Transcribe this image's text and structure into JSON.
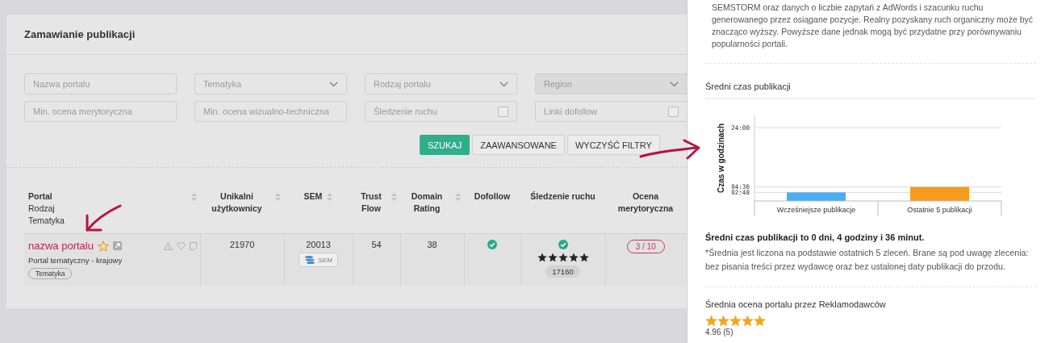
{
  "page": {
    "title": "Zamawianie publikacji"
  },
  "filters": [
    {
      "kind": "text",
      "placeholder": "Nazwa portalu"
    },
    {
      "kind": "select",
      "placeholder": "Tematyka",
      "disabled": false
    },
    {
      "kind": "select",
      "placeholder": "Rodzaj portalu",
      "disabled": false
    },
    {
      "kind": "select",
      "placeholder": "Region",
      "disabled": true
    },
    {
      "kind": "text",
      "placeholder": "Min. ocena merytoryczna"
    },
    {
      "kind": "text",
      "placeholder": "Min. ocena wizualno-techniczna"
    },
    {
      "kind": "checkbox",
      "label": "Śledzenie ruchu",
      "checked": false
    },
    {
      "kind": "checkbox",
      "label": "Linki dofollow",
      "checked": false
    }
  ],
  "buttons": [
    {
      "label": "SZUKAJ",
      "kind": "primary"
    },
    {
      "label": "ZAAWANSOWANE",
      "kind": "default"
    },
    {
      "label": "WYCZYŚĆ FILTRY",
      "kind": "default"
    }
  ],
  "table": {
    "columns": [
      {
        "label": "Portal",
        "sublabels": [
          "Rodzaj",
          "Tematyka"
        ],
        "sortable": true
      },
      {
        "label": "Unikalni użytkownicy",
        "sortable": true
      },
      {
        "label": "SEM",
        "sortable": true
      },
      {
        "label": "Trust Flow",
        "sortable": true
      },
      {
        "label": "Domain Rating",
        "sortable": true
      },
      {
        "label": "Dofollow",
        "sortable": false
      },
      {
        "label": "Śledzenie ruchu",
        "sortable": false
      },
      {
        "label": "Ocena merytoryczna",
        "sortable": false
      }
    ],
    "rows": [
      {
        "portal_name": "nazwa portalu",
        "favorite": false,
        "portal_type": "Portal tematyczny - krajowy",
        "tag": "Tematyka",
        "unique_users": "21970",
        "sem": "20013",
        "sem_badge": "SEM",
        "trust_flow": "54",
        "domain_rating": "38",
        "dofollow": true,
        "tracking": true,
        "stars": 5,
        "tracking_count": "17160",
        "rating": "3 / 10"
      }
    ]
  },
  "panel": {
    "intro": "SEMSTORM oraz danych o liczbie zapytań z AdWords i szacunku ruchu generowanego przez osiągane pozycje. Realny pozyskany ruch organiczny może być znacząco wyższy. Powyższe dane jednak mogą być przydatne przy porównywaniu popularności portali.",
    "time_section": {
      "title": "Średni czas publikacji",
      "chart_data": {
        "type": "bar",
        "ylabel": "Czas w godzinach",
        "categories": [
          "Wcześniejsze publikacje",
          "Ostatnie 5 publikacji"
        ],
        "series": [
          {
            "color": "#4aaef5",
            "values": [
              2.8,
              null
            ]
          },
          {
            "color": "#f59c1f",
            "values": [
              null,
              4.6
            ]
          }
        ],
        "ylim": [
          0,
          28
        ],
        "grid": true,
        "yticks": [
          {
            "value": 2.8,
            "label": "02:48"
          },
          {
            "value": 4.6,
            "label": "04:36"
          },
          {
            "value": 24,
            "label": "24:00"
          }
        ]
      },
      "summary": "Średni czas publikacji to 0 dni, 4 godziny i 36 minut.",
      "note": "*Średnia jest liczona na podstawie ostatnich 5 zleceń. Brane są pod uwagę zlecenia: bez pisania treści przez wydawcę oraz bez ustalonej daty publikacji do przodu."
    },
    "rating_section": {
      "title": "Średnia ocena portalu przez Reklamodawców",
      "stars": 5,
      "score": "4.96 (5)"
    }
  }
}
